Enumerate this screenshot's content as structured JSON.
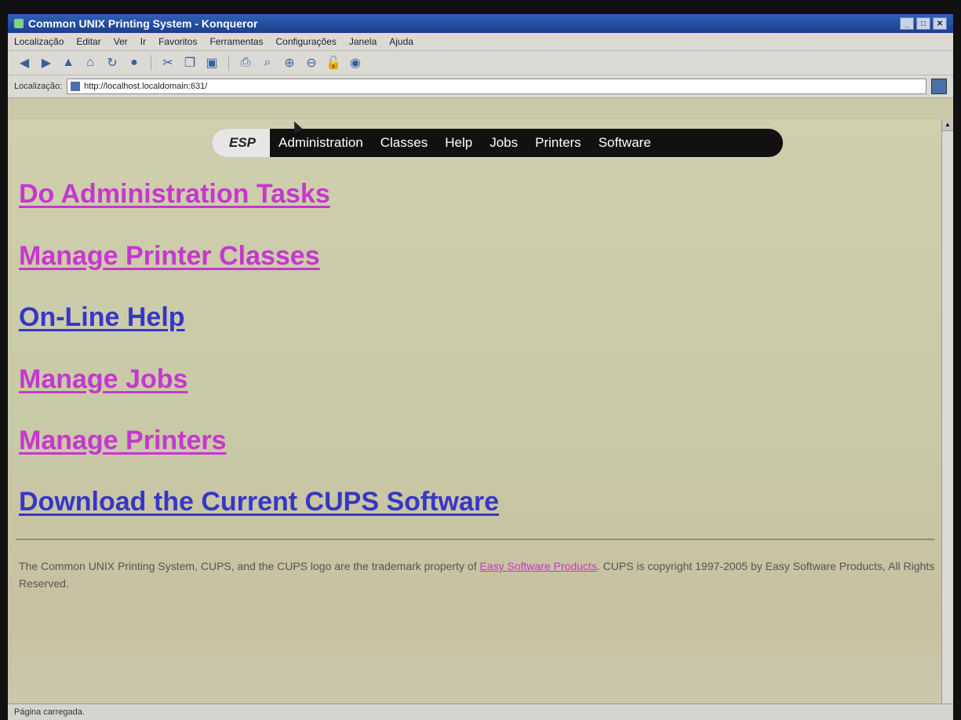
{
  "window": {
    "title": "Common UNIX Printing System - Konqueror",
    "controls": [
      "_",
      "□",
      "✕"
    ]
  },
  "menu": [
    "Localização",
    "Editar",
    "Ver",
    "Ir",
    "Favoritos",
    "Ferramentas",
    "Configurações",
    "Janela",
    "Ajuda"
  ],
  "toolbar": {
    "icons": [
      "back-icon",
      "forward-icon",
      "up-icon",
      "home-icon",
      "reload-icon",
      "stop-icon",
      "cut-icon",
      "copy-icon",
      "paste-icon",
      "print-icon",
      "find-icon",
      "zoom-in-icon",
      "zoom-out-icon",
      "security-icon",
      "extension-icon"
    ]
  },
  "location": {
    "label": "Localização:",
    "url": "http://localhost.localdomain:631/"
  },
  "nav": {
    "brand": "ESP",
    "items": [
      "Administration",
      "Classes",
      "Help",
      "Jobs",
      "Printers",
      "Software"
    ]
  },
  "links": [
    {
      "label": "Do Administration Tasks",
      "color": "#c637d0"
    },
    {
      "label": "Manage Printer Classes",
      "color": "#c637d0"
    },
    {
      "label": "On-Line Help",
      "color": "#3636c8"
    },
    {
      "label": "Manage Jobs",
      "color": "#c637d0"
    },
    {
      "label": "Manage Printers",
      "color": "#c637d0"
    },
    {
      "label": "Download the Current CUPS Software",
      "color": "#3636c8"
    }
  ],
  "footer": {
    "text_before": "The Common UNIX Printing System, CUPS, and the CUPS logo are the trademark property of ",
    "link": "Easy Software Products",
    "text_after": ". CUPS is copyright 1997-2005 by Easy Software Products, All Rights Reserved."
  },
  "status": {
    "text": "Página carregada."
  }
}
